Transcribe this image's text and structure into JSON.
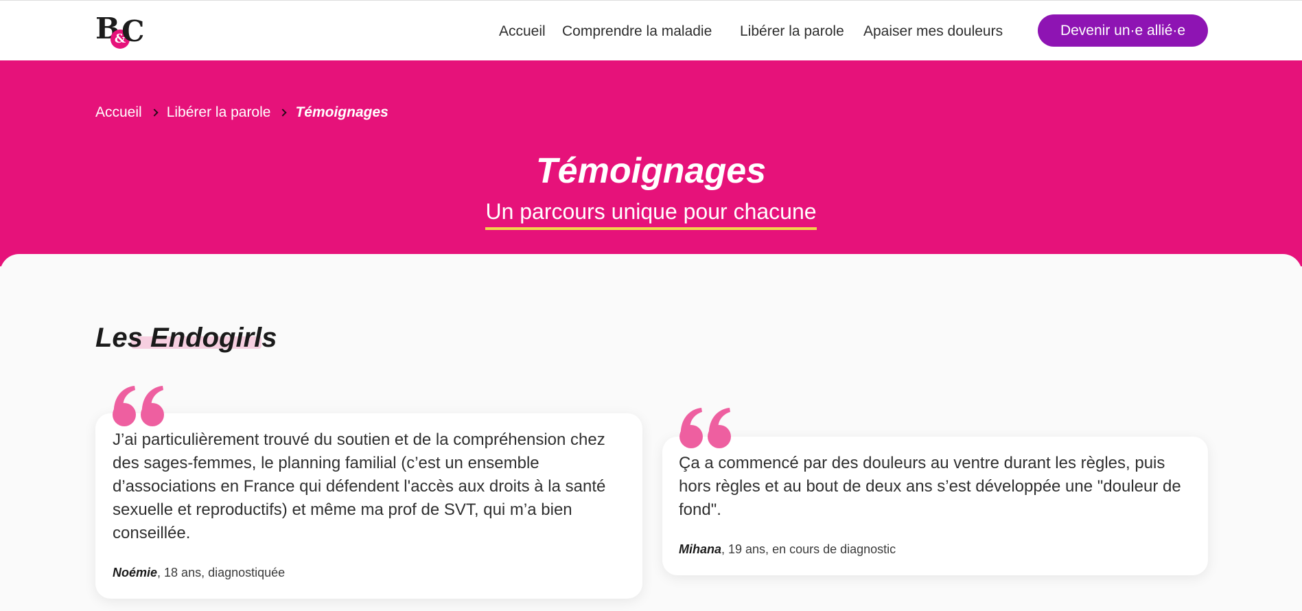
{
  "header": {
    "logo_text": "B&C",
    "nav": [
      "Accueil",
      "Comprendre la maladie",
      "Libérer la parole",
      "Apaiser mes douleurs"
    ],
    "cta_label": "Devenir un·e allié·e"
  },
  "breadcrumb": {
    "items": [
      "Accueil",
      "Libérer la parole"
    ],
    "current": "Témoignages"
  },
  "hero": {
    "title": "Témoignages",
    "subtitle": "Un parcours unique pour chacune"
  },
  "section": {
    "title": "Les Endogirls"
  },
  "testimonials": [
    {
      "text": "J’ai particulièrement trouvé du soutien et de la compréhension chez des sages-femmes, le planning familial (c’est un ensemble d’associations en France qui défendent l'accès aux droits à la santé sexuelle et reproductifs) et même ma prof de SVT, qui m’a bien conseillée.",
      "name": "Noémie",
      "details": ", 18 ans, diagnostiquée"
    },
    {
      "text": "Ça a commencé par des douleurs au ventre durant les règles, puis hors règles et au bout de deux ans s’est développée une \"douleur de fond\".",
      "name": "Mihana",
      "details": ", 19 ans, en cours de diagnostic"
    }
  ],
  "colors": {
    "brand_pink": "#e6127a",
    "cta_purple": "#8e14b3",
    "underline_yellow": "#f2d64b",
    "quote_pink": "#ee5fa0"
  },
  "icons": {
    "quote": "quote-icon",
    "breadcrumb_separator": "chevron-right-icon"
  }
}
